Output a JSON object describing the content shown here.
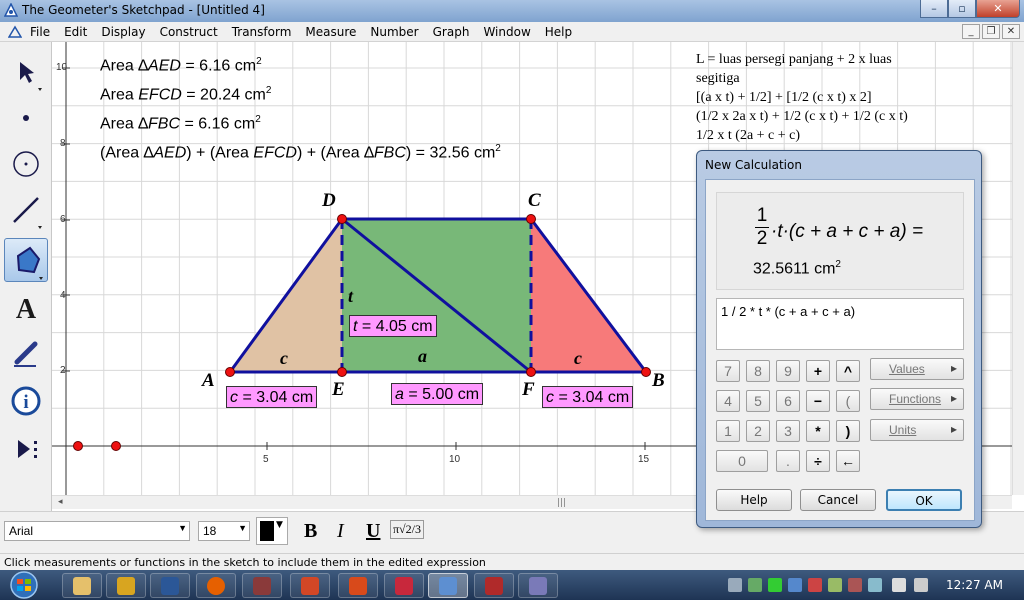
{
  "window": {
    "title": "The Geometer's Sketchpad - [Untitled 4]",
    "min_label": "–",
    "max_label": "▫",
    "close_label": "✕"
  },
  "menu": {
    "items": [
      "File",
      "Edit",
      "Display",
      "Construct",
      "Transform",
      "Measure",
      "Number",
      "Graph",
      "Window",
      "Help"
    ],
    "mdi_min": "_",
    "mdi_restore": "❐",
    "mdi_close": "✕"
  },
  "toolbox": {
    "tools": [
      "arrow-tool",
      "point-tool",
      "compass-tool",
      "straightedge-tool",
      "polygon-tool",
      "text-tool",
      "marker-tool",
      "information-tool",
      "custom-tool"
    ],
    "active": "polygon-tool"
  },
  "measurements": {
    "area_aed_prefix": "Area ∆",
    "area_aed_name": "AED",
    "area_aed_value": " = 6.16 cm",
    "area_efcd_prefix": "Area ",
    "area_efcd_name": "EFCD",
    "area_efcd_value": " = 20.24 cm",
    "area_fbc_prefix": "Area ∆",
    "area_fbc_name": "FBC",
    "area_fbc_value": " = 6.16 cm",
    "sum_p1": "(Area ∆",
    "sum_n1": "AED",
    "sum_p2": ") + (Area ",
    "sum_n2": "EFCD",
    "sum_p3": ") + (Area ∆",
    "sum_n3": "FBC",
    "sum_p4": ") = 32.56 cm",
    "sq": "2"
  },
  "notes": {
    "lines": [
      "L = luas persegi panjang + 2 x luas",
      "segitiga",
      "[(a x t) + 1/2] + [1/2 (c x t) x 2]",
      "(1/2 x 2a x t) + 1/2 (c x t) + 1/2 (c x t)",
      "1/2 x t (2a + c + c)"
    ]
  },
  "geometry": {
    "points": {
      "A": "A",
      "B": "B",
      "C": "C",
      "D": "D",
      "E": "E",
      "F": "F"
    },
    "segments": {
      "c_left": "c",
      "a": "a",
      "c_right": "c",
      "t": "t"
    },
    "labels": {
      "t_var": "t",
      "t_val": " = 4.05 cm",
      "c1_var": "c",
      "c1_val": " = 3.04 cm",
      "a_var": "a",
      "a_val": " = 5.00 cm",
      "c2_var": "c",
      "c2_val": " = 3.04 cm"
    },
    "y_ticks": [
      "10",
      "8",
      "6",
      "4",
      "2"
    ],
    "x_ticks": [
      "5",
      "10",
      "15"
    ],
    "colors": {
      "left_triangle": "#e0c2a4",
      "rectangle": "#78b878",
      "right_triangle": "#f77a7a",
      "outline": "#10109e",
      "point": "#ee1111"
    }
  },
  "format_bar": {
    "font": "Arial",
    "size": "18",
    "bold": "B",
    "italic": "I",
    "underline": "U",
    "math": "π√2/3"
  },
  "status": {
    "text": "Click measurements or functions in the sketch to include them in the edited expression"
  },
  "taskbar": {
    "clock": "12:27 AM"
  },
  "dialog": {
    "title": "New Calculation",
    "preview_num": "1",
    "preview_den": "2",
    "preview_expr": "·t·(c + a + c + a) =",
    "preview_result": "32.5611 cm",
    "preview_sq": "2",
    "expression": "1 / 2 * t * (c + a + c + a)",
    "keys": [
      "7",
      "8",
      "9",
      "+",
      "^",
      "4",
      "5",
      "6",
      "−",
      "(",
      "1",
      "2",
      "3",
      "*",
      ")",
      "0",
      ".",
      "÷",
      "←"
    ],
    "values_label": "Values",
    "functions_label": "Functions",
    "units_label": "Units",
    "help_label": "Help",
    "cancel_label": "Cancel",
    "ok_label": "OK"
  }
}
